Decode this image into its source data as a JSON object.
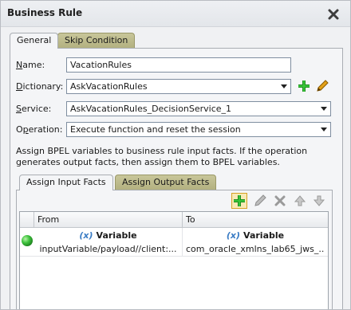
{
  "dialog": {
    "title": "Business Rule"
  },
  "tabs": [
    {
      "label": "General"
    },
    {
      "label": "Skip Condition"
    }
  ],
  "form": {
    "name_label_key": "N",
    "name_label_rest": "ame:",
    "name_value": "VacationRules",
    "dictionary_label_key": "D",
    "dictionary_label_rest": "ictionary:",
    "dictionary_value": "AskVacationRules",
    "service_label_key": "S",
    "service_label_rest": "ervice:",
    "service_value": "AskVacationRules_DecisionService_1",
    "operation_label_pre": "O",
    "operation_label_key": "p",
    "operation_label_rest": "eration:",
    "operation_value": "Execute function and reset the session"
  },
  "description": {
    "line1": "Assign BPEL variables to business rule input facts. If the operation",
    "line2": "generates output facts, then assign them to BPEL variables."
  },
  "inner_tabs": [
    {
      "label": "Assign Input Facts"
    },
    {
      "label": "Assign Output Facts"
    }
  ],
  "icons": {
    "close": "close-icon",
    "add": "plus-icon",
    "edit": "pencil-icon",
    "delete": "x-icon",
    "up": "arrow-up-icon",
    "down": "arrow-down-icon",
    "status": "green-circle-icon"
  },
  "table": {
    "columns": [
      "From",
      "To"
    ],
    "rows": [
      {
        "from_type": "Variable",
        "from_path": "inputVariable/payload//client:...",
        "to_type": "Variable",
        "to_path": "com_oracle_xmlns_lab65_jws_..."
      }
    ],
    "var_symbol": "(x)"
  },
  "colors": {
    "accent_blue": "#3a7cc4",
    "add_green": "#2fa82f",
    "status_green": "#2fbf2f"
  }
}
